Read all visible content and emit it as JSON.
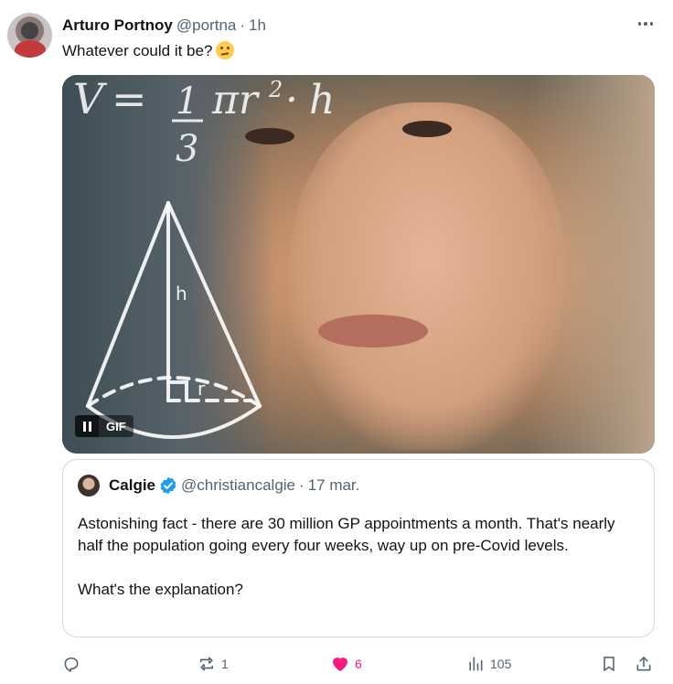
{
  "tweet": {
    "author_name": "Arturo Portnoy",
    "author_handle": "@portna",
    "separator": "·",
    "time": "1h",
    "text": "Whatever could it be?",
    "emoji": "thinking-face-emoji"
  },
  "media": {
    "formula": "V = 1/3 πr² · h",
    "gif_label": "GIF",
    "pause_icon": "pause-icon"
  },
  "quote": {
    "author_name": "Calgie",
    "author_handle": "@christiancalgie",
    "separator": "·",
    "date": "17 mar.",
    "verified": true,
    "verified_color": "#1d9bf0",
    "paragraphs": [
      "Astonishing fact - there are 30 million GP appointments a month. That's nearly half the population going every four weeks, way up on pre-Covid levels.",
      "What's the explanation?"
    ]
  },
  "actions": {
    "reply": {
      "icon": "reply-icon",
      "count": ""
    },
    "retweet": {
      "icon": "retweet-icon",
      "count": "1"
    },
    "like": {
      "icon": "heart-icon",
      "count": "6",
      "active": true,
      "color": "#f91880"
    },
    "views": {
      "icon": "views-icon",
      "count": "105"
    },
    "bookmark": {
      "icon": "bookmark-icon"
    },
    "share": {
      "icon": "share-icon"
    }
  },
  "colors": {
    "text": "#0f1419",
    "secondary": "#536471",
    "border": "#cfd9de",
    "accent": "#1d9bf0"
  }
}
